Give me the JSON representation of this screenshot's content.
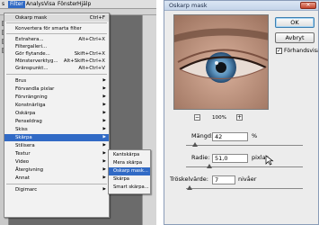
{
  "menubar": {
    "items": [
      {
        "label": "s",
        "active": false
      },
      {
        "label": "Filter",
        "active": true
      },
      {
        "label": "Analys",
        "active": false
      },
      {
        "label": "Visa",
        "active": false
      },
      {
        "label": "Fönster",
        "active": false
      },
      {
        "label": "Hjälp",
        "active": false
      }
    ]
  },
  "filter_menu": {
    "items": [
      {
        "label": "Oskarp mask",
        "shortcut": "Ctrl+F"
      },
      {
        "label": "Konvertera för smarta filter",
        "shortcut": ""
      },
      {
        "label": "Extrahera...",
        "shortcut": "Alt+Ctrl+X"
      },
      {
        "label": "Filtergalleri...",
        "shortcut": ""
      },
      {
        "label": "Gör flytande...",
        "shortcut": "Skift+Ctrl+X"
      },
      {
        "label": "Mönsterverktyg...",
        "shortcut": "Alt+Skift+Ctrl+X"
      },
      {
        "label": "Gränspunkt...",
        "shortcut": "Alt+Ctrl+V"
      },
      {
        "label": "Brus"
      },
      {
        "label": "Förvandla pixlar"
      },
      {
        "label": "Förvrängning"
      },
      {
        "label": "Konstnärliga"
      },
      {
        "label": "Oskärpa"
      },
      {
        "label": "Penseldrag"
      },
      {
        "label": "Skiss"
      },
      {
        "label": "Skärpa"
      },
      {
        "label": "Stilisera"
      },
      {
        "label": "Textur"
      },
      {
        "label": "Video"
      },
      {
        "label": "Återgivning"
      },
      {
        "label": "Annat"
      },
      {
        "label": "Digimarc"
      }
    ]
  },
  "submenu": {
    "items": [
      "Kantskärpa",
      "Mera skärpa",
      "Oskarp mask...",
      "Skärpa",
      "Smart skärpa..."
    ],
    "active_index": 2
  },
  "dialog": {
    "title": "Oskarp mask",
    "close_glyph": "×",
    "ok_label": "OK",
    "cancel_label": "Avbryt",
    "preview_label": "Förhandsvisa",
    "preview_checked": true,
    "zoom": {
      "minus": "−",
      "value": "100%",
      "plus": "+"
    },
    "amount": {
      "label": "Mängd:",
      "value": "42",
      "unit": "%",
      "slider_fraction": 0.08
    },
    "radius": {
      "label": "Radie:",
      "value": "51,0",
      "unit": "pixlar",
      "slider_fraction": 0.2
    },
    "threshold": {
      "label": "Tröskelvärde:",
      "value": "7",
      "unit": "nivåer",
      "slider_fraction": 0.03
    },
    "checkmark": "✓"
  },
  "colors": {
    "menu_highlight": "#316ac5",
    "iris": "#4a86b8"
  }
}
